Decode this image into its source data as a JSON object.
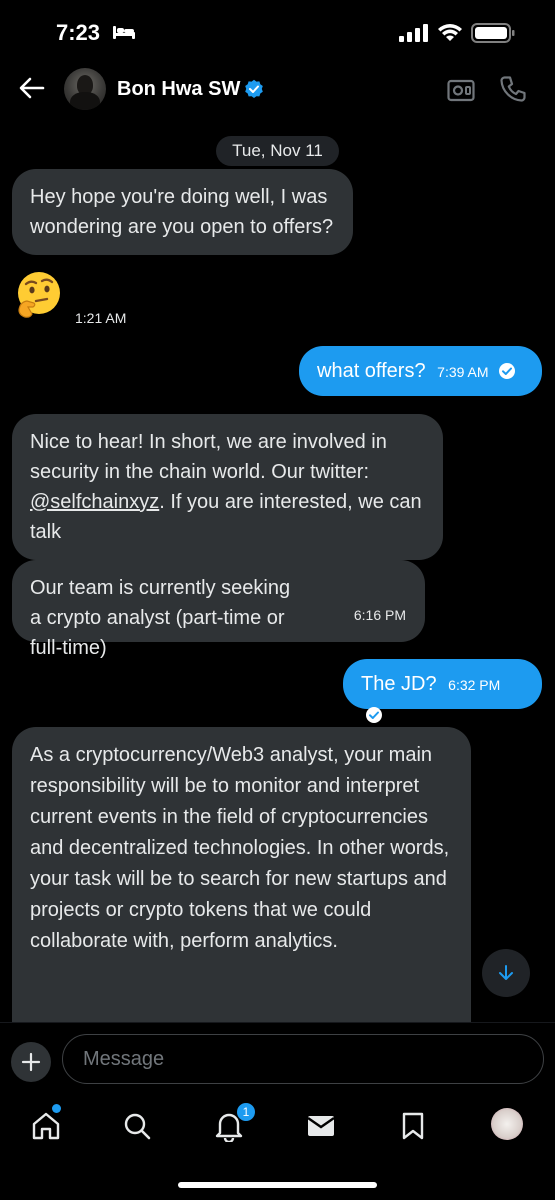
{
  "status_bar": {
    "time": "7:23"
  },
  "header": {
    "name": "Bon Hwa SW"
  },
  "date_separator": "Tue, Nov 11",
  "messages": {
    "m1": {
      "text": "Hey hope you're doing well, I was wondering are you open to offers?"
    },
    "m2": {
      "time": "1:21 AM"
    },
    "m3": {
      "text": "what offers?",
      "time": "7:39 AM"
    },
    "m4": {
      "text_before": "Nice to hear! In short, we are involved in security in the chain world. Our twitter: ",
      "mention": "@selfchainxyz",
      "text_after": ". If you are interested, we can talk"
    },
    "m5": {
      "text": "Our team is currently seeking a crypto analyst (part-time or full-time)",
      "time": "6:16 PM"
    },
    "m6": {
      "text": "The JD?",
      "time": "6:32 PM"
    },
    "m7": {
      "text": "As a cryptocurrency/Web3 analyst, your main responsibility will be to monitor and interpret current events in the field of cryptocurrencies and decentralized technologies. In other words, your task will be to search for new startups and projects or crypto tokens that we could collaborate with, perform analytics."
    }
  },
  "composer": {
    "placeholder": "Message"
  },
  "nav": {
    "notifications_count": "1"
  },
  "colors": {
    "accent": "#1d9bf0",
    "incoming_bubble": "#2f3336",
    "background": "#000000"
  },
  "icons": [
    "back-arrow-icon",
    "verified-badge-icon",
    "video-call-icon",
    "phone-icon",
    "thinking-face-emoji",
    "arrow-down-icon",
    "plus-icon",
    "home-icon",
    "search-icon",
    "bell-icon",
    "mail-icon",
    "bookmark-icon"
  ]
}
